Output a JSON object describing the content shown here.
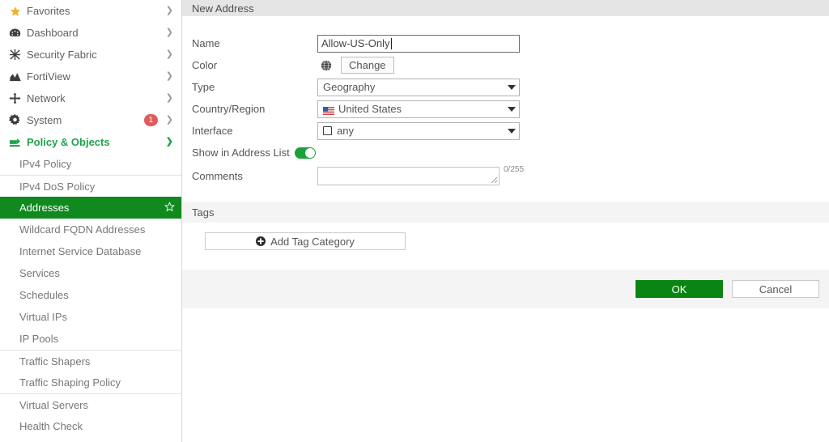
{
  "sidebar": {
    "top_items": [
      {
        "label": "Favorites",
        "icon": "star-icon",
        "chevron": "right",
        "badge": null
      },
      {
        "label": "Dashboard",
        "icon": "dashboard-icon",
        "chevron": "right",
        "badge": null
      },
      {
        "label": "Security Fabric",
        "icon": "security-fabric-icon",
        "chevron": "right",
        "badge": null
      },
      {
        "label": "FortiView",
        "icon": "fortiview-icon",
        "chevron": "right",
        "badge": null
      },
      {
        "label": "Network",
        "icon": "network-icon",
        "chevron": "right",
        "badge": null
      },
      {
        "label": "System",
        "icon": "gear-icon",
        "chevron": "right",
        "badge": "1"
      },
      {
        "label": "Policy & Objects",
        "icon": "policy-objects-icon",
        "chevron": "down",
        "badge": null
      }
    ],
    "sub_items": [
      {
        "label": "IPv4 Policy",
        "selected": false,
        "separator_above": false
      },
      {
        "label": "IPv4 DoS Policy",
        "selected": false,
        "separator_above": true
      },
      {
        "label": "Addresses",
        "selected": true,
        "separator_above": false,
        "star": "☆"
      },
      {
        "label": "Wildcard FQDN Addresses",
        "selected": false,
        "separator_above": false
      },
      {
        "label": "Internet Service Database",
        "selected": false,
        "separator_above": false
      },
      {
        "label": "Services",
        "selected": false,
        "separator_above": false
      },
      {
        "label": "Schedules",
        "selected": false,
        "separator_above": false
      },
      {
        "label": "Virtual IPs",
        "selected": false,
        "separator_above": false
      },
      {
        "label": "IP Pools",
        "selected": false,
        "separator_above": false
      },
      {
        "label": "Traffic Shapers",
        "selected": false,
        "separator_above": true
      },
      {
        "label": "Traffic Shaping Policy",
        "selected": false,
        "separator_above": false
      },
      {
        "label": "Virtual Servers",
        "selected": false,
        "separator_above": true
      },
      {
        "label": "Health Check",
        "selected": false,
        "separator_above": false
      }
    ]
  },
  "panel": {
    "title": "New Address"
  },
  "form": {
    "name": {
      "label": "Name",
      "value": "Allow-US-Only"
    },
    "color": {
      "label": "Color",
      "swatch_icon": "globe-icon",
      "change_button": "Change"
    },
    "type": {
      "label": "Type",
      "value": "Geography"
    },
    "country_region": {
      "label": "Country/Region",
      "value": "United States",
      "flag_icon": "us-flag-icon"
    },
    "interface": {
      "label": "Interface",
      "value": "any",
      "icon": "interface-icon"
    },
    "show_in_address_list": {
      "label": "Show in Address List",
      "enabled": true
    },
    "comments": {
      "label": "Comments",
      "value": "",
      "char_count": "0/255"
    }
  },
  "tags": {
    "section_title": "Tags",
    "add_button": "Add Tag Category",
    "add_icon": "plus-circle-icon"
  },
  "footer": {
    "ok_label": "OK",
    "cancel_label": "Cancel"
  },
  "colors": {
    "brand_green": "#0a8511",
    "selected_green": "#108a1f",
    "toggle_green": "#1ca138",
    "badge_red": "#e15b5b",
    "header_gray": "#e5e5e5",
    "section_gray": "#f4f4f4"
  }
}
